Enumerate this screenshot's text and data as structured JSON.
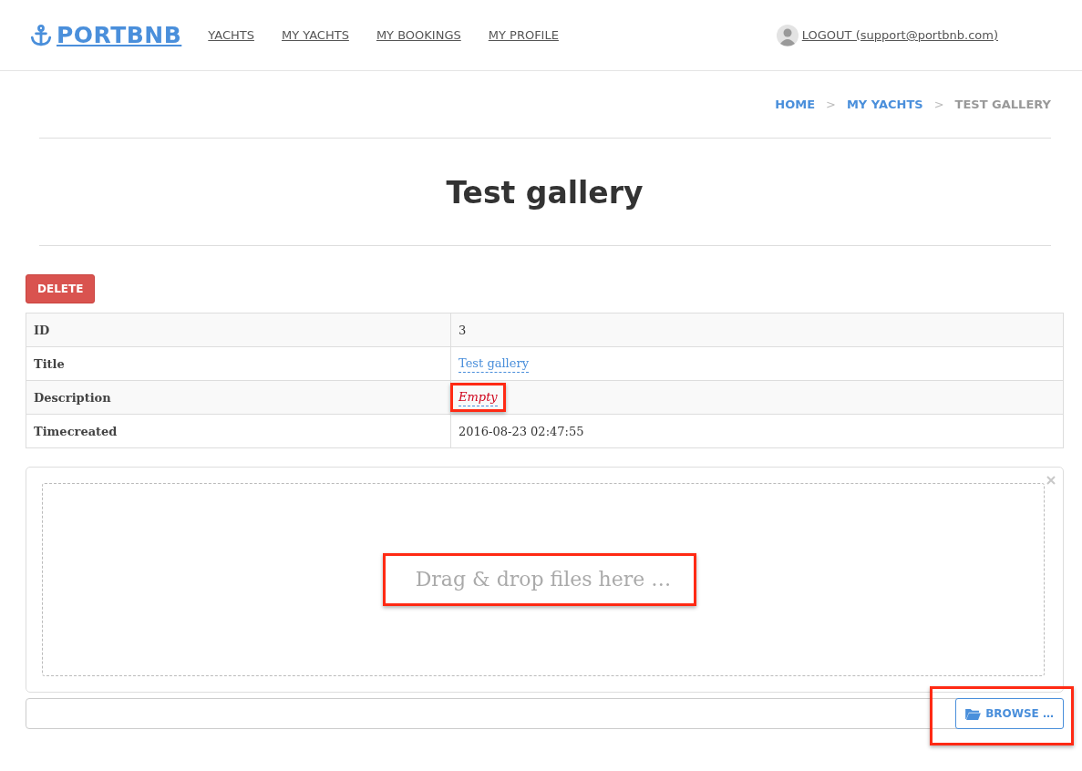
{
  "brand": {
    "name": "PORTBNB"
  },
  "nav": [
    {
      "label": "YACHTS"
    },
    {
      "label": "MY YACHTS"
    },
    {
      "label": "MY BOOKINGS"
    },
    {
      "label": "MY PROFILE"
    }
  ],
  "account": {
    "label": "LOGOUT (support@portbnb.com)"
  },
  "breadcrumb": [
    {
      "label": "HOME",
      "selected": false
    },
    {
      "label": "MY YACHTS",
      "selected": false
    },
    {
      "label": "TEST GALLERY",
      "selected": true
    }
  ],
  "breadcrumb_separator": ">",
  "page_title": "Test gallery",
  "delete_button": "DELETE",
  "details": [
    {
      "label": "ID",
      "value": "3",
      "kind": "text"
    },
    {
      "label": "Title",
      "value": "Test gallery",
      "kind": "editable"
    },
    {
      "label": "Description",
      "value": "Empty",
      "kind": "empty",
      "highlighted": true
    },
    {
      "label": "Timecreated",
      "value": "2016-08-23 02:47:55",
      "kind": "text"
    }
  ],
  "upload": {
    "dropzone_text": "Drag & drop files here …",
    "dropzone_highlighted": true,
    "browse_label": "BROWSE …",
    "browse_highlighted": true
  }
}
